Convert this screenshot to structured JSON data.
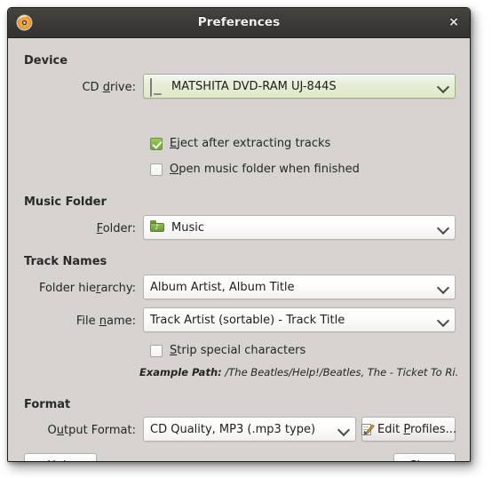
{
  "window": {
    "title": "Preferences",
    "app_icon": "cd-disc-icon",
    "close_label": "×"
  },
  "device": {
    "group_title": "Device",
    "cd_drive_label_pre": "CD ",
    "cd_drive_label_accel": "d",
    "cd_drive_label_post": "rive:",
    "cd_drive_value": "MATSHITA DVD-RAM UJ-844S",
    "cd_drive_icon": "optical-drive-icon",
    "eject_label_pre": "",
    "eject_label_accel": "E",
    "eject_label_post": "ject after extracting tracks",
    "eject_checked": true,
    "open_folder_label_pre": "",
    "open_folder_label_accel": "O",
    "open_folder_label_post": "pen music folder when finished",
    "open_folder_checked": false
  },
  "music_folder": {
    "group_title": "Music Folder",
    "folder_label_pre": "",
    "folder_label_accel": "F",
    "folder_label_post": "older:",
    "folder_value": "Music",
    "folder_icon": "music-folder-icon"
  },
  "track_names": {
    "group_title": "Track Names",
    "hierarchy_label_pre": "Folder hie",
    "hierarchy_label_accel": "r",
    "hierarchy_label_post": "archy:",
    "hierarchy_value": "Album Artist, Album Title",
    "filename_label_pre": "File ",
    "filename_label_accel": "n",
    "filename_label_post": "ame:",
    "filename_value": "Track Artist (sortable) - Track Title",
    "strip_label_pre": "",
    "strip_label_accel": "S",
    "strip_label_post": "trip special characters",
    "strip_checked": false,
    "example_label": "Example Path:",
    "example_value": "/The Beatles/Help!/Beatles, The - Ticket To Ri…"
  },
  "format": {
    "group_title": "Format",
    "output_label_pre": "O",
    "output_label_accel": "u",
    "output_label_post": "tput Format:",
    "output_value": "CD Quality, MP3 (.mp3 type)",
    "edit_profiles_pre": "Edit ",
    "edit_profiles_accel": "P",
    "edit_profiles_post": "rofiles...",
    "edit_profiles_icon": "pencil-edit-icon"
  },
  "footer": {
    "help_pre": "",
    "help_accel": "H",
    "help_post": "elp",
    "close_pre": "",
    "close_accel": "C",
    "close_post": "lose"
  },
  "colors": {
    "titlebar": "#3a3935",
    "dialog_bg": "#d6d3d0",
    "accent_green": "#73a63a",
    "focus_green_bg": "#dde9c8",
    "text": "#1d1d1b"
  }
}
